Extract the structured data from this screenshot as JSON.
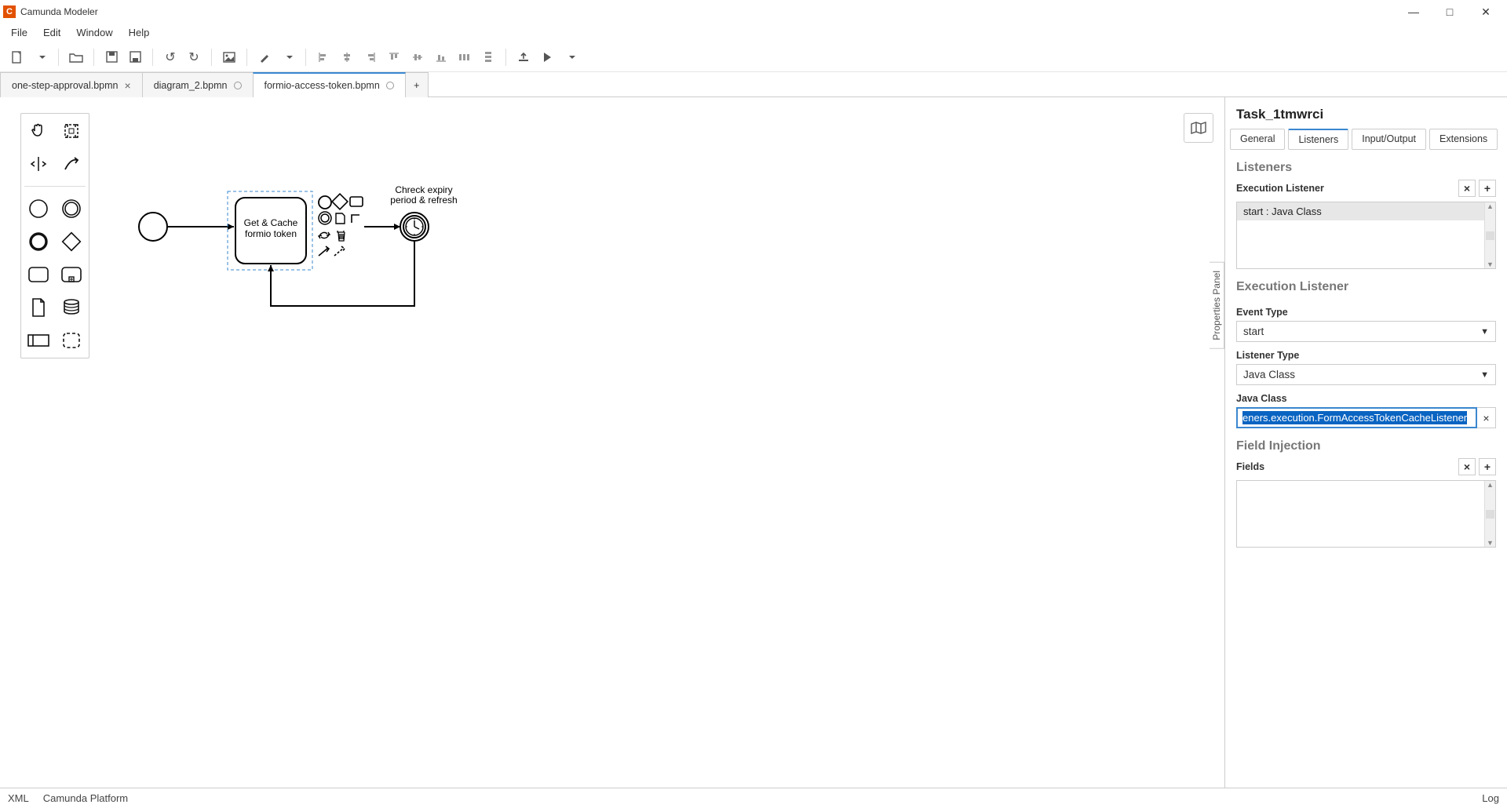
{
  "window": {
    "title": "Camunda Modeler"
  },
  "menu": {
    "file": "File",
    "edit": "Edit",
    "window": "Window",
    "help": "Help"
  },
  "tabs": [
    {
      "label": "one-step-approval.bpmn",
      "closable": true,
      "dirty": false,
      "active": false
    },
    {
      "label": "diagram_2.bpmn",
      "closable": false,
      "dirty": true,
      "active": false
    },
    {
      "label": "formio-access-token.bpmn",
      "closable": false,
      "dirty": true,
      "active": true
    }
  ],
  "canvas": {
    "task_label": "Get & Cache formio token",
    "annotation": "Chreck expiry period & refresh"
  },
  "panel_toggle": "Properties Panel",
  "properties": {
    "title": "Task_1tmwrci",
    "tabs": {
      "general": "General",
      "listeners": "Listeners",
      "io": "Input/Output",
      "extensions": "Extensions"
    },
    "section_listeners": "Listeners",
    "exec_listener_label": "Execution Listener",
    "exec_listener_row": "start : Java Class",
    "section_exec_listener": "Execution Listener",
    "event_type_label": "Event Type",
    "event_type_value": "start",
    "listener_type_label": "Listener Type",
    "listener_type_value": "Java Class",
    "java_class_label": "Java Class",
    "java_class_value": "eners.execution.FormAccessTokenCacheListener",
    "section_field_injection": "Field Injection",
    "fields_label": "Fields"
  },
  "status": {
    "xml": "XML",
    "platform": "Camunda Platform",
    "log": "Log"
  }
}
